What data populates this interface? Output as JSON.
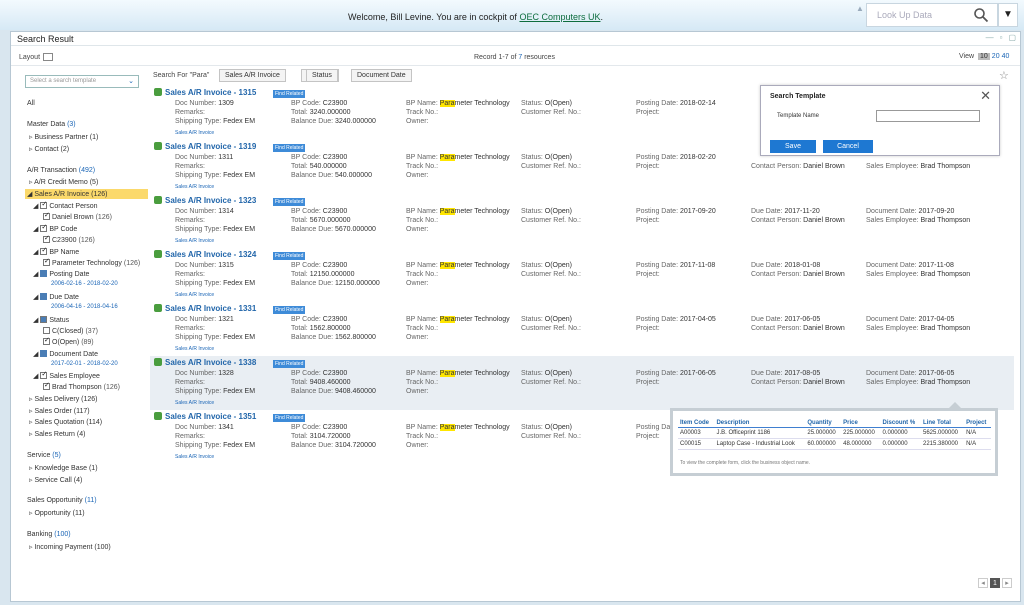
{
  "header": {
    "welcome_prefix": "Welcome, Bill Levine. You are in cockpit of ",
    "company": "OEC Computers UK",
    "welcome_suffix": ".",
    "lookup_placeholder": "Look Up Data"
  },
  "window": {
    "title": "Search Result"
  },
  "toolbar": {
    "layout_label": "Layout",
    "records_prefix": "Record 1-7 of ",
    "records_total": "7",
    "records_suffix": " resources",
    "view_label": "View",
    "view_options": [
      "10",
      "20",
      "40"
    ]
  },
  "sidebar": {
    "template_placeholder": "Select a search template",
    "all": "All",
    "master_data": "Master Data",
    "master_data_count": "(3)",
    "business_partner": "Business Partner",
    "business_partner_count": "(1)",
    "contact": "Contact",
    "contact_count": "(2)",
    "ar_transaction": "A/R Transaction",
    "ar_transaction_count": "(492)",
    "ar_credit_memo": "A/R Credit Memo",
    "ar_credit_memo_count": "(5)",
    "sales_ar_invoice": "Sales A/R Invoice",
    "sales_ar_invoice_count": "(126)",
    "contact_person": "Contact Person",
    "daniel_brown": "Daniel Brown",
    "daniel_brown_count": "(126)",
    "bp_code": "BP Code",
    "c23900": "C23900",
    "c23900_count": "(126)",
    "bp_name": "BP Name",
    "param_tech": "Parameter Technology",
    "param_tech_count": "(126)",
    "posting_date": "Posting Date",
    "posting_range": "2006-02-16 - 2018-02-20",
    "due_date": "Due Date",
    "due_range": "2006-04-16 - 2018-04-16",
    "status": "Status",
    "closed": "C(Closed)",
    "closed_count": "(37)",
    "open": "O(Open)",
    "open_count": "(89)",
    "document_date": "Document Date",
    "document_range": "2017-02-01 - 2018-02-20",
    "sales_employee": "Sales Employee",
    "brad": "Brad Thompson",
    "brad_count": "(126)",
    "sales_delivery": "Sales Delivery",
    "sales_delivery_count": "(126)",
    "sales_order": "Sales Order",
    "sales_order_count": "(117)",
    "sales_quotation": "Sales Quotation",
    "sales_quotation_count": "(114)",
    "sales_return": "Sales Return",
    "sales_return_count": "(4)",
    "service": "Service",
    "service_count": "(5)",
    "knowledge_base": "Knowledge Base",
    "knowledge_base_count": "(1)",
    "service_call": "Service Call",
    "service_call_count": "(4)",
    "sales_opportunity": "Sales Opportunity",
    "sales_opportunity_count": "(11)",
    "opportunity": "Opportunity",
    "opportunity_count": "(11)",
    "banking": "Banking",
    "banking_count": "(100)",
    "incoming_payment": "Incoming Payment",
    "incoming_payment_count": "(100)"
  },
  "filter": {
    "search_for": "Search For",
    "term": "\"Para\"",
    "chips": [
      "Sales A/R Invoice",
      "Status",
      "Document Date"
    ]
  },
  "labels": {
    "find_related": "Find Related",
    "doc_number": "Doc Number:",
    "remarks": "Remarks:",
    "shipping": "Shipping Type:",
    "bp_code": "BP Code:",
    "total": "Total:",
    "balance": "Balance Due:",
    "bp_name": "BP Name:",
    "bp_highlight": "Para",
    "bp_rest": "meter Technology",
    "track": "Track No.:",
    "owner": "Owner:",
    "status": "Status:",
    "status_val": "O(Open)",
    "customer_ref": "Customer Ref. No.:",
    "posting": "Posting Date:",
    "project": "Project:",
    "due": "Due Date:",
    "contact": "Contact Person:",
    "contact_val": "Daniel Brown",
    "document": "Document Date:",
    "employee": "Sales Employee:",
    "employee_val": "Brad Thompson",
    "bp_code_val": "C23900",
    "ship_val": "Fedex EM",
    "sub_link": "Sales A/R Invoice"
  },
  "records": [
    {
      "title": "Sales A/R Invoice - 1315",
      "doc": "1309",
      "total": "3240.000000",
      "balance": "3240.000000",
      "posting": "2018-02-14",
      "due": "",
      "document": ""
    },
    {
      "title": "Sales A/R Invoice - 1319",
      "doc": "1311",
      "total": "540.000000",
      "balance": "540.000000",
      "posting": "2018-02-20",
      "due": "",
      "document": ""
    },
    {
      "title": "Sales A/R Invoice - 1323",
      "doc": "1314",
      "total": "5670.000000",
      "balance": "5670.000000",
      "posting": "2017-09-20",
      "due": "2017-11-20",
      "document": "2017-09-20"
    },
    {
      "title": "Sales A/R Invoice - 1324",
      "doc": "1315",
      "total": "12150.000000",
      "balance": "12150.000000",
      "posting": "2017-11-08",
      "due": "2018-01-08",
      "document": "2017-11-08"
    },
    {
      "title": "Sales A/R Invoice - 1331",
      "doc": "1321",
      "total": "1562.800000",
      "balance": "1562.800000",
      "posting": "2017-04-05",
      "due": "2017-06-05",
      "document": "2017-04-05"
    },
    {
      "title": "Sales A/R Invoice - 1338",
      "doc": "1328",
      "total": "9408.460000",
      "balance": "9408.460000",
      "posting": "2017-06-05",
      "due": "2017-08-05",
      "document": "2017-06-05"
    },
    {
      "title": "Sales A/R Invoice - 1351",
      "doc": "1341",
      "total": "3104.720000",
      "balance": "3104.720000",
      "posting": "",
      "due": "",
      "document": ""
    }
  ],
  "dialog": {
    "title": "Search Template",
    "field_label": "Template Name",
    "save": "Save",
    "cancel": "Cancel"
  },
  "popup": {
    "headers": [
      "Item Code",
      "Description",
      "Quantity",
      "Price",
      "Discount %",
      "Line Total",
      "Project"
    ],
    "rows": [
      [
        "A00003",
        "J.B. Officeprint 1186",
        "25.000000",
        "225.000000",
        "0.000000",
        "5625.000000",
        "N/A"
      ],
      [
        "C00015",
        "Laptop Case - Industrial Look",
        "60.000000",
        "48.000000",
        "0.000000",
        "2215.380000",
        "N/A"
      ]
    ],
    "note": "To view the complete form, click the business object name."
  },
  "pager": {
    "page": "1"
  },
  "colors": {
    "accent": "#1a65b6",
    "selected": "#fbd96b",
    "button": "#1e78d2"
  }
}
